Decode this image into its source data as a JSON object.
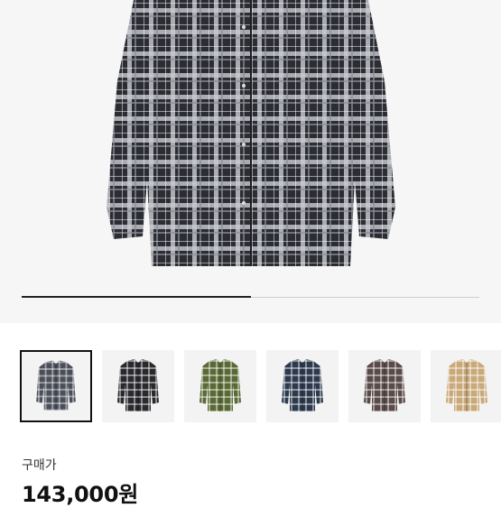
{
  "product": {
    "main_image_icon": "plaid-shirt-image",
    "gallery_progress": 0.5,
    "thumbnails": [
      {
        "icon": "plaid-shirt-black-grey",
        "color": "#4b4f5a",
        "selected": true
      },
      {
        "icon": "plaid-shirt-black",
        "color": "#2a2a2e",
        "selected": false
      },
      {
        "icon": "plaid-shirt-olive",
        "color": "#5a6a35",
        "selected": false
      },
      {
        "icon": "plaid-shirt-navy",
        "color": "#2d3a4e",
        "selected": false
      },
      {
        "icon": "plaid-shirt-red-grey",
        "color": "#5b4a4a",
        "selected": false
      },
      {
        "icon": "plaid-shirt-beige",
        "color": "#c9a97a",
        "selected": false
      }
    ],
    "price_label": "구매가",
    "price_value": "143,000원"
  }
}
